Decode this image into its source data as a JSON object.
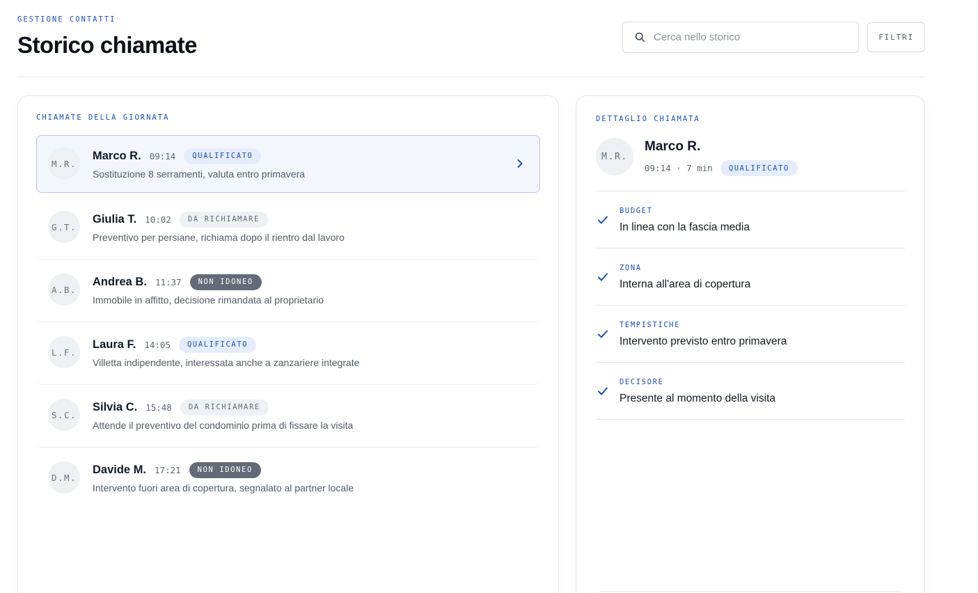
{
  "header": {
    "eyebrow": "GESTIONE CONTATTI",
    "title": "Storico chiamate",
    "search_placeholder": "Cerca nello storico",
    "filter_label": "FILTRI"
  },
  "list": {
    "section_label": "CHIAMATE DELLA GIORNATA",
    "calls": [
      {
        "initials": "M.R.",
        "name": "Marco R.",
        "time": "09:14",
        "status": "QUALIFICATO",
        "description": "Sostituzione 8 serramenti, valuta entro primavera"
      },
      {
        "initials": "G.T.",
        "name": "Giulia T.",
        "time": "10:02",
        "status": "DA RICHIAMARE",
        "description": "Preventivo per persiane, richiama dopo il rientro dal lavoro"
      },
      {
        "initials": "A.B.",
        "name": "Andrea B.",
        "time": "11:37",
        "status": "NON IDONEO",
        "description": "Immobile in affitto, decisione rimandata al proprietario"
      },
      {
        "initials": "L.F.",
        "name": "Laura F.",
        "time": "14:05",
        "status": "QUALIFICATO",
        "description": "Villetta indipendente, interessata anche a zanzariere integrate"
      },
      {
        "initials": "S.C.",
        "name": "Silvia C.",
        "time": "15:48",
        "status": "DA RICHIAMARE",
        "description": "Attende il preventivo del condominio prima di fissare la visita"
      },
      {
        "initials": "D.M.",
        "name": "Davide M.",
        "time": "17:21",
        "status": "NON IDONEO",
        "description": "Intervento fuori area di copertura, segnalato al partner locale"
      }
    ]
  },
  "detail": {
    "section_label": "DETTAGLIO CHIAMATA",
    "initials": "M.R.",
    "name": "Marco R.",
    "meta": "09:14 · 7 min",
    "status": "QUALIFICATO",
    "criteria": [
      {
        "label": "BUDGET",
        "value": "In linea con la fascia media"
      },
      {
        "label": "ZONA",
        "value": "Interna all'area di copertura"
      },
      {
        "label": "TEMPISTICHE",
        "value": "Intervento previsto entro primavera"
      },
      {
        "label": "DECISORE",
        "value": "Presente al momento della visita"
      }
    ]
  },
  "colors": {
    "accent": "#1d4fb0",
    "badge_qualified_bg": "#e5edfd",
    "badge_callback_bg": "#eef0f3",
    "badge_unfit_bg": "#646b77",
    "selected_row_bg": "#f3f6fd"
  },
  "icons": {
    "search": "search-icon",
    "chevron": "chevron-right-icon",
    "check": "check-icon"
  }
}
